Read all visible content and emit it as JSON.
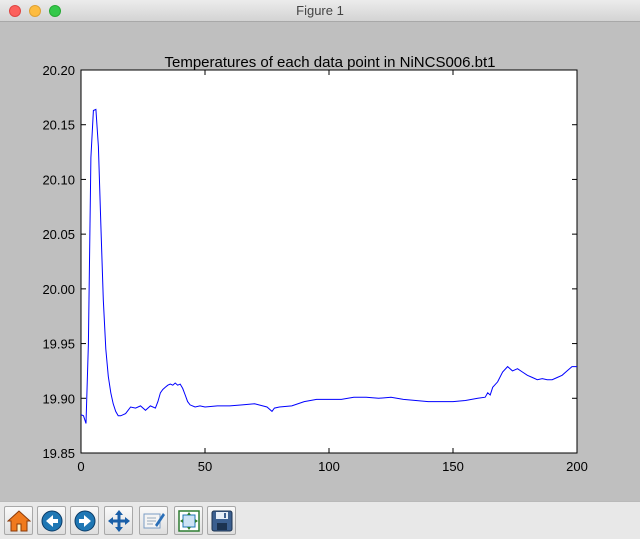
{
  "window": {
    "title": "Figure 1"
  },
  "toolbar": {
    "buttons": [
      {
        "icon": "home-icon"
      },
      {
        "icon": "back-arrow-icon"
      },
      {
        "icon": "forward-arrow-icon"
      },
      {
        "icon": "pan-icon"
      },
      {
        "icon": "zoom-rect-icon"
      },
      {
        "icon": "configure-subplots-icon"
      },
      {
        "icon": "save-icon"
      }
    ]
  },
  "chart_data": {
    "type": "line",
    "title": "Temperatures of each data point in NiNCS006.bt1",
    "xlabel": "",
    "ylabel": "",
    "xlim": [
      0,
      200
    ],
    "ylim": [
      19.85,
      20.2
    ],
    "xticks": [
      "0",
      "50",
      "100",
      "150",
      "200"
    ],
    "yticks": [
      "19.85",
      "19.90",
      "19.95",
      "20.00",
      "20.05",
      "20.10",
      "20.15",
      "20.20"
    ],
    "grid": false,
    "color": "#0000ff",
    "x": [
      0,
      1,
      2,
      3,
      4,
      5,
      6,
      7,
      8,
      9,
      10,
      11,
      12,
      13,
      14,
      15,
      16,
      17,
      18,
      19,
      20,
      22,
      24,
      26,
      28,
      30,
      31,
      32,
      33,
      34,
      35,
      36,
      37,
      38,
      39,
      40,
      41,
      42,
      43,
      44,
      46,
      48,
      50,
      55,
      60,
      65,
      70,
      75,
      77,
      78,
      80,
      85,
      90,
      95,
      100,
      105,
      110,
      115,
      120,
      125,
      130,
      135,
      140,
      145,
      150,
      155,
      160,
      163,
      164,
      165,
      166,
      168,
      170,
      172,
      174,
      176,
      178,
      180,
      182,
      184,
      186,
      188,
      190,
      192,
      194,
      196,
      198,
      200
    ],
    "y": [
      19.885,
      19.884,
      19.877,
      19.95,
      20.12,
      20.163,
      20.164,
      20.13,
      20.06,
      19.99,
      19.945,
      19.92,
      19.905,
      19.895,
      19.888,
      19.884,
      19.884,
      19.885,
      19.886,
      19.889,
      19.892,
      19.891,
      19.893,
      19.889,
      19.893,
      19.891,
      19.897,
      19.905,
      19.908,
      19.91,
      19.912,
      19.913,
      19.912,
      19.914,
      19.912,
      19.913,
      19.909,
      19.903,
      19.897,
      19.894,
      19.892,
      19.893,
      19.892,
      19.893,
      19.893,
      19.894,
      19.895,
      19.892,
      19.888,
      19.891,
      19.892,
      19.893,
      19.897,
      19.899,
      19.899,
      19.899,
      19.901,
      19.901,
      19.9,
      19.901,
      19.899,
      19.898,
      19.897,
      19.897,
      19.897,
      19.898,
      19.9,
      19.901,
      19.905,
      19.903,
      19.91,
      19.915,
      19.924,
      19.929,
      19.925,
      19.927,
      19.924,
      19.921,
      19.919,
      19.917,
      19.918,
      19.917,
      19.917,
      19.919,
      19.921,
      19.925,
      19.929,
      19.929
    ]
  }
}
